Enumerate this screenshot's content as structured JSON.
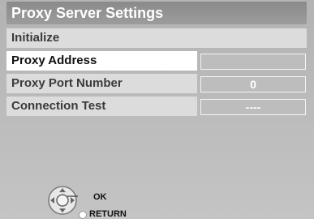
{
  "screen": {
    "title": "Proxy Server Settings"
  },
  "menu": {
    "initialize": "Initialize",
    "proxy_address_label": "Proxy Address",
    "proxy_address_value": "",
    "proxy_port_label": "Proxy Port Number",
    "proxy_port_value": "0",
    "connection_test_label": "Connection Test",
    "connection_test_value": "----"
  },
  "controls": {
    "ok_label": "OK",
    "return_label": "RETURN",
    "pad_icon": "directional-pad-icon"
  },
  "colors": {
    "background": "#bdbdbd",
    "title_bar": "#8e8e8e",
    "row": "#dcdcdc",
    "selected_row": "#ffffff",
    "text": "#3a3a3a"
  }
}
